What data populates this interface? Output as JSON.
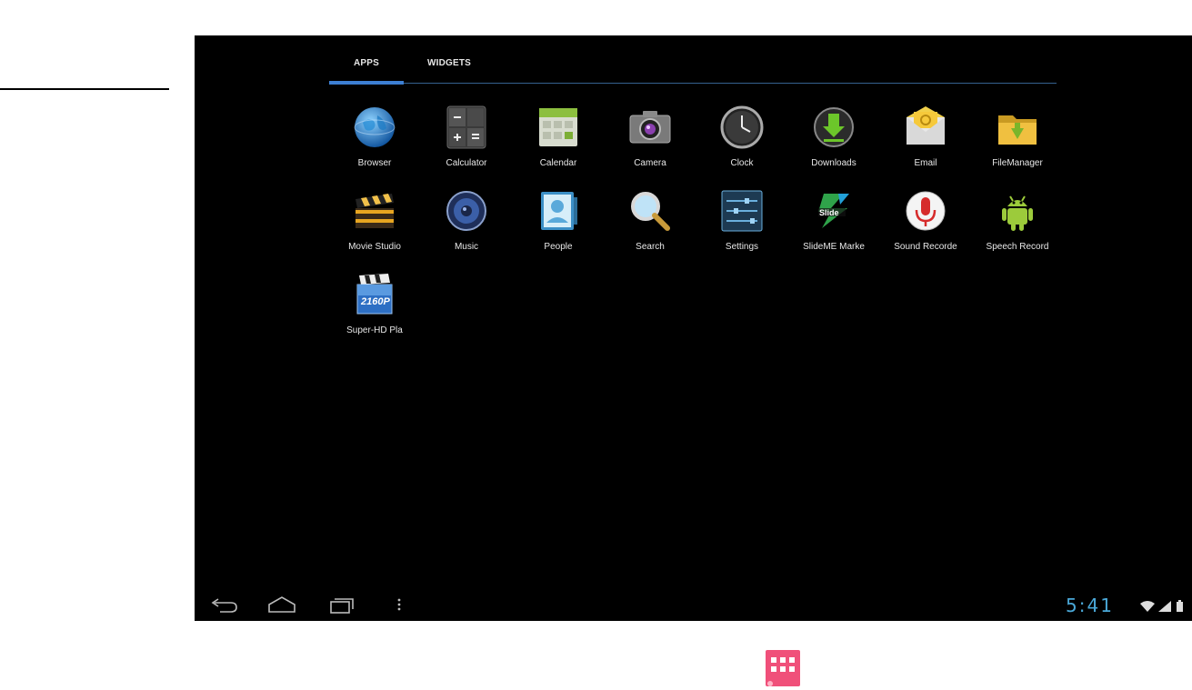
{
  "tabs": {
    "apps": "APPS",
    "widgets": "WIDGETS"
  },
  "apps": [
    {
      "label": "Browser",
      "icon": "globe-icon"
    },
    {
      "label": "Calculator",
      "icon": "calculator-icon"
    },
    {
      "label": "Calendar",
      "icon": "calendar-icon"
    },
    {
      "label": "Camera",
      "icon": "camera-icon"
    },
    {
      "label": "Clock",
      "icon": "clock-icon"
    },
    {
      "label": "Downloads",
      "icon": "download-icon"
    },
    {
      "label": "Email",
      "icon": "email-icon"
    },
    {
      "label": "FileManager",
      "icon": "folder-icon"
    },
    {
      "label": "Movie Studio",
      "icon": "clapperboard-icon"
    },
    {
      "label": "Music",
      "icon": "speaker-icon"
    },
    {
      "label": "People",
      "icon": "contact-icon"
    },
    {
      "label": "Search",
      "icon": "magnifier-icon"
    },
    {
      "label": "Settings",
      "icon": "sliders-icon"
    },
    {
      "label": "SlideME Marke",
      "icon": "slideme-icon"
    },
    {
      "label": "Sound Recorde",
      "icon": "microphone-icon"
    },
    {
      "label": "Speech Record",
      "icon": "android-icon"
    },
    {
      "label": "Super-HD Pla",
      "icon": "video-player-icon"
    }
  ],
  "status": {
    "time": "5:41"
  },
  "colors": {
    "accent": "#3d7fd3",
    "clock": "#4aa8d8",
    "launcher": "#f0507a"
  }
}
